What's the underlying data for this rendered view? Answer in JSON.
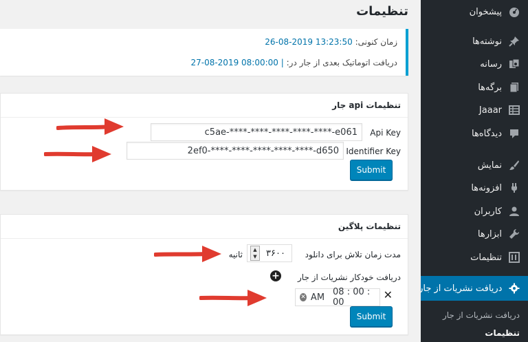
{
  "page": {
    "title": "تنظیمات"
  },
  "sidebar": {
    "items": [
      {
        "label": "پیشخوان",
        "icon": "dashboard-icon"
      },
      {
        "label": "نوشته‌ها",
        "icon": "pin-icon"
      },
      {
        "label": "رسانه",
        "icon": "media-icon"
      },
      {
        "label": "برگه‌ها",
        "icon": "pages-icon"
      },
      {
        "label": "Jaaar",
        "icon": "grid-icon"
      },
      {
        "label": "دیدگاه‌ها",
        "icon": "comment-icon"
      },
      {
        "label": "نمایش",
        "icon": "brush-icon"
      },
      {
        "label": "افزونه‌ها",
        "icon": "plugin-icon"
      },
      {
        "label": "کاربران",
        "icon": "user-icon"
      },
      {
        "label": "ابزارها",
        "icon": "wrench-icon"
      },
      {
        "label": "تنظیمات",
        "icon": "settings-icon"
      },
      {
        "label": "دریافت نشریات از جار",
        "icon": "gear-icon"
      }
    ],
    "submenu": [
      {
        "label": "دریافت نشریات از جار"
      },
      {
        "label": "تنظیمات"
      }
    ]
  },
  "notice": {
    "current_time_label": "زمان کنونی:",
    "current_time_value": "26-08-2019 13:23:50",
    "next_fetch_label": "دریافت اتوماتیک بعدی از جار در:",
    "next_fetch_value": "27-08-2019 08:00:00 |"
  },
  "api_card": {
    "title": "تنظیمات api جار",
    "api_key_label": "Api Key",
    "api_key_value": "c5ae-****-****-****-****-****-e061",
    "identifier_label": "Identifier Key",
    "identifier_value": "2ef0-****-****-****-****-****-d650",
    "submit": "Submit"
  },
  "plugin_card": {
    "title": "تنظیمات پلاگین",
    "duration_label": "مدت زمان تلاش برای دانلود",
    "duration_value": "۳۶۰۰",
    "duration_unit": "ثانیه",
    "auto_fetch_label": "دریافت خودکار نشریات از جار",
    "time_value": "08 : 00 : 00",
    "time_ampm": "AM",
    "submit": "Submit"
  },
  "colors": {
    "accent": "#0073aa",
    "sidebar": "#23282d",
    "arrow": "#e03b2f",
    "notice_border": "#00a0d2"
  }
}
